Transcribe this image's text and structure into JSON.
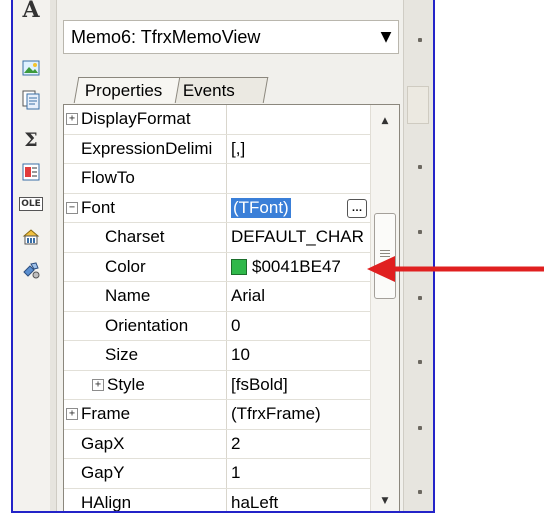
{
  "combo": {
    "value": "Memo6: TfrxMemoView"
  },
  "tabs": [
    {
      "label": "Properties",
      "active": true
    },
    {
      "label": "Events",
      "active": false
    }
  ],
  "properties": [
    {
      "name": "DisplayFormat",
      "value": "",
      "expandable": true,
      "expanded": false,
      "indent": 0
    },
    {
      "name": "ExpressionDelimi",
      "value": "[,]",
      "expandable": false,
      "indent": 0
    },
    {
      "name": "FlowTo",
      "value": "",
      "expandable": false,
      "indent": 0
    },
    {
      "name": "Font",
      "value": "(TFont)",
      "expandable": true,
      "expanded": true,
      "indent": 0,
      "selected_value": true,
      "ellipsis": "…"
    },
    {
      "name": "Charset",
      "value": "DEFAULT_CHAR",
      "expandable": false,
      "indent": 1
    },
    {
      "name": "Color",
      "value": "$0041BE47",
      "expandable": false,
      "indent": 1,
      "swatch": "#2fb84a"
    },
    {
      "name": "Name",
      "value": "Arial",
      "expandable": false,
      "indent": 1
    },
    {
      "name": "Orientation",
      "value": "0",
      "expandable": false,
      "indent": 1
    },
    {
      "name": "Size",
      "value": "10",
      "expandable": false,
      "indent": 1
    },
    {
      "name": "Style",
      "value": "[fsBold]",
      "expandable": true,
      "expanded": false,
      "indent": 1
    },
    {
      "name": "Frame",
      "value": "(TfrxFrame)",
      "expandable": true,
      "expanded": false,
      "indent": 0
    },
    {
      "name": "GapX",
      "value": "2",
      "expandable": false,
      "indent": 0
    },
    {
      "name": "GapY",
      "value": "1",
      "expandable": false,
      "indent": 0
    },
    {
      "name": "HAlign",
      "value": "haLeft",
      "expandable": false,
      "indent": 0
    }
  ],
  "toolbar": [
    {
      "icon": "text-object-icon"
    },
    {
      "icon": "picture-object-icon"
    },
    {
      "icon": "subreport-icon"
    },
    {
      "icon": "aggregate-sum-icon"
    },
    {
      "icon": "system-text-icon"
    },
    {
      "icon": "ole-object-icon",
      "label": "OLE"
    },
    {
      "icon": "database-object-icon"
    },
    {
      "icon": "tools-icon"
    }
  ],
  "colors": {
    "selection": "#3a7fd8",
    "swatch": "#2fb84a",
    "arrow": "#e02020",
    "frame_border": "#2323c8"
  }
}
